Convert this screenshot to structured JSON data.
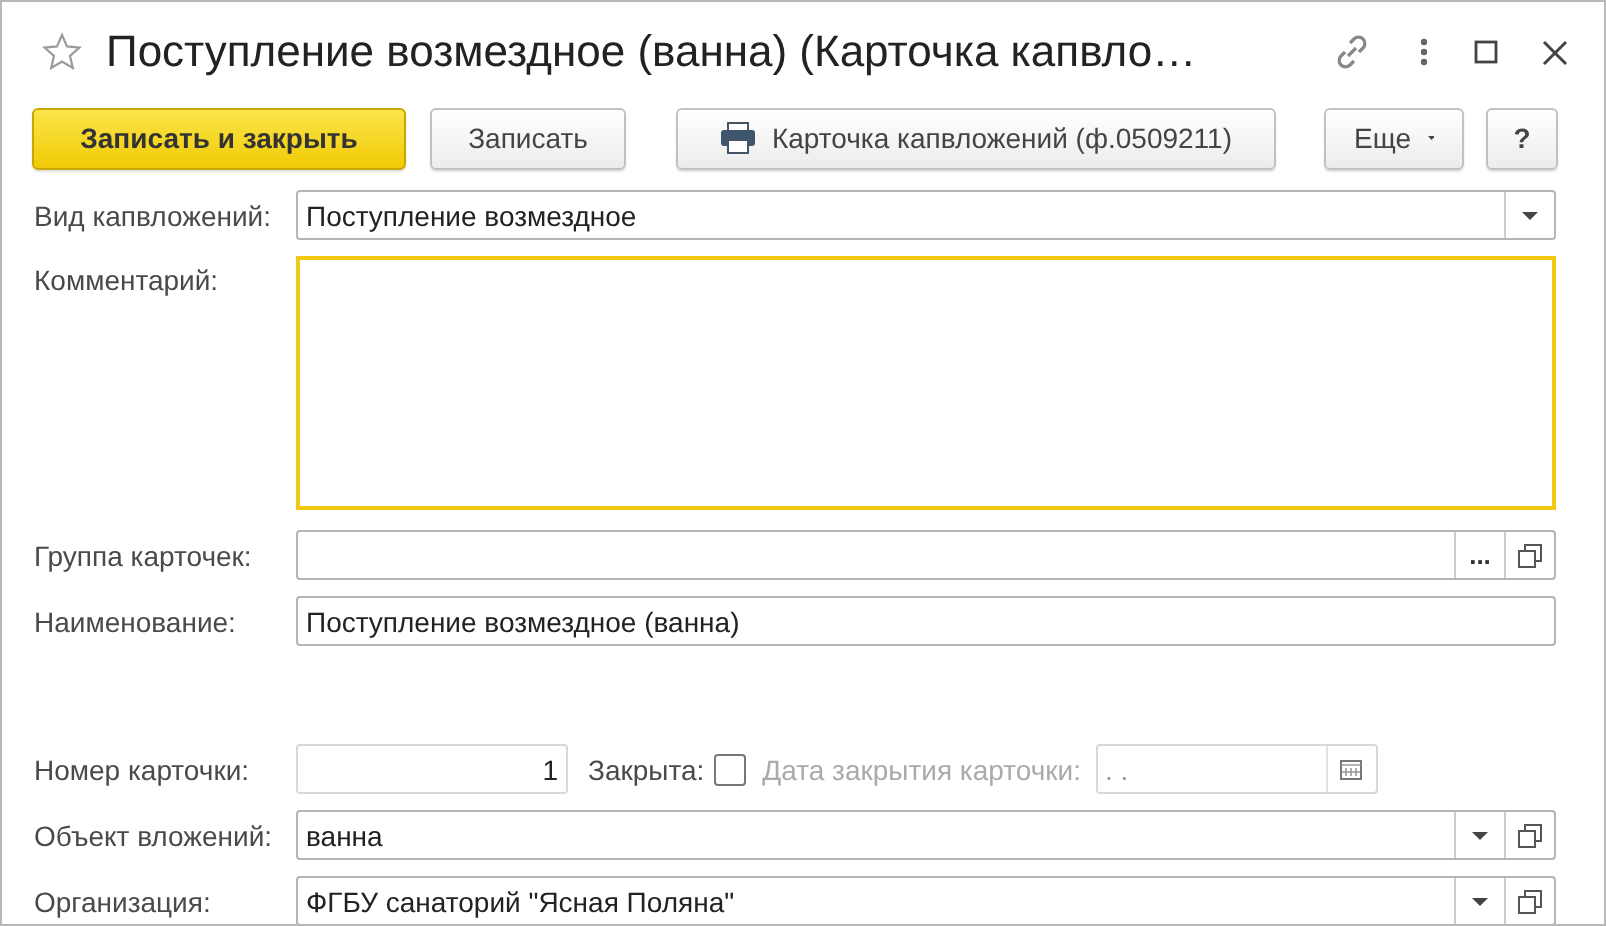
{
  "window": {
    "title": "Поступление возмездное (ванна) (Карточка капвло…",
    "favorite": false
  },
  "toolbar": [
    {
      "kind": "primary",
      "label": "Записать и закрыть"
    },
    {
      "kind": "plain",
      "label": "Записать"
    },
    {
      "kind": "print",
      "label": "Карточка капвложений (ф.0509211)"
    },
    {
      "kind": "menu",
      "label": "Еще"
    },
    {
      "kind": "help",
      "label": "?"
    }
  ],
  "fields": [
    {
      "kind": "select",
      "label": "Вид капвложений:",
      "value": "Поступление возмездное"
    },
    {
      "kind": "textarea",
      "label": "Комментарий:",
      "focused": true
    },
    {
      "kind": "lookup",
      "label": "Группа карточек:",
      "choice": "..."
    },
    {
      "kind": "text",
      "label": "Наименование:",
      "value": "Поступление возмездное (ванна)"
    },
    {
      "kind": "card",
      "label": "Номер карточки:",
      "value": "1",
      "closed_label": "Закрыта:",
      "closed": false,
      "date_label": "Дата закрытия карточки:",
      "date_value": ". .",
      "date_disabled": true
    },
    {
      "kind": "select_open",
      "label": "Объект вложений:",
      "value": "ванна"
    },
    {
      "kind": "select_open",
      "label": "Организация:",
      "value": "ФГБУ санаторий \"Ясная Поляна\""
    }
  ]
}
